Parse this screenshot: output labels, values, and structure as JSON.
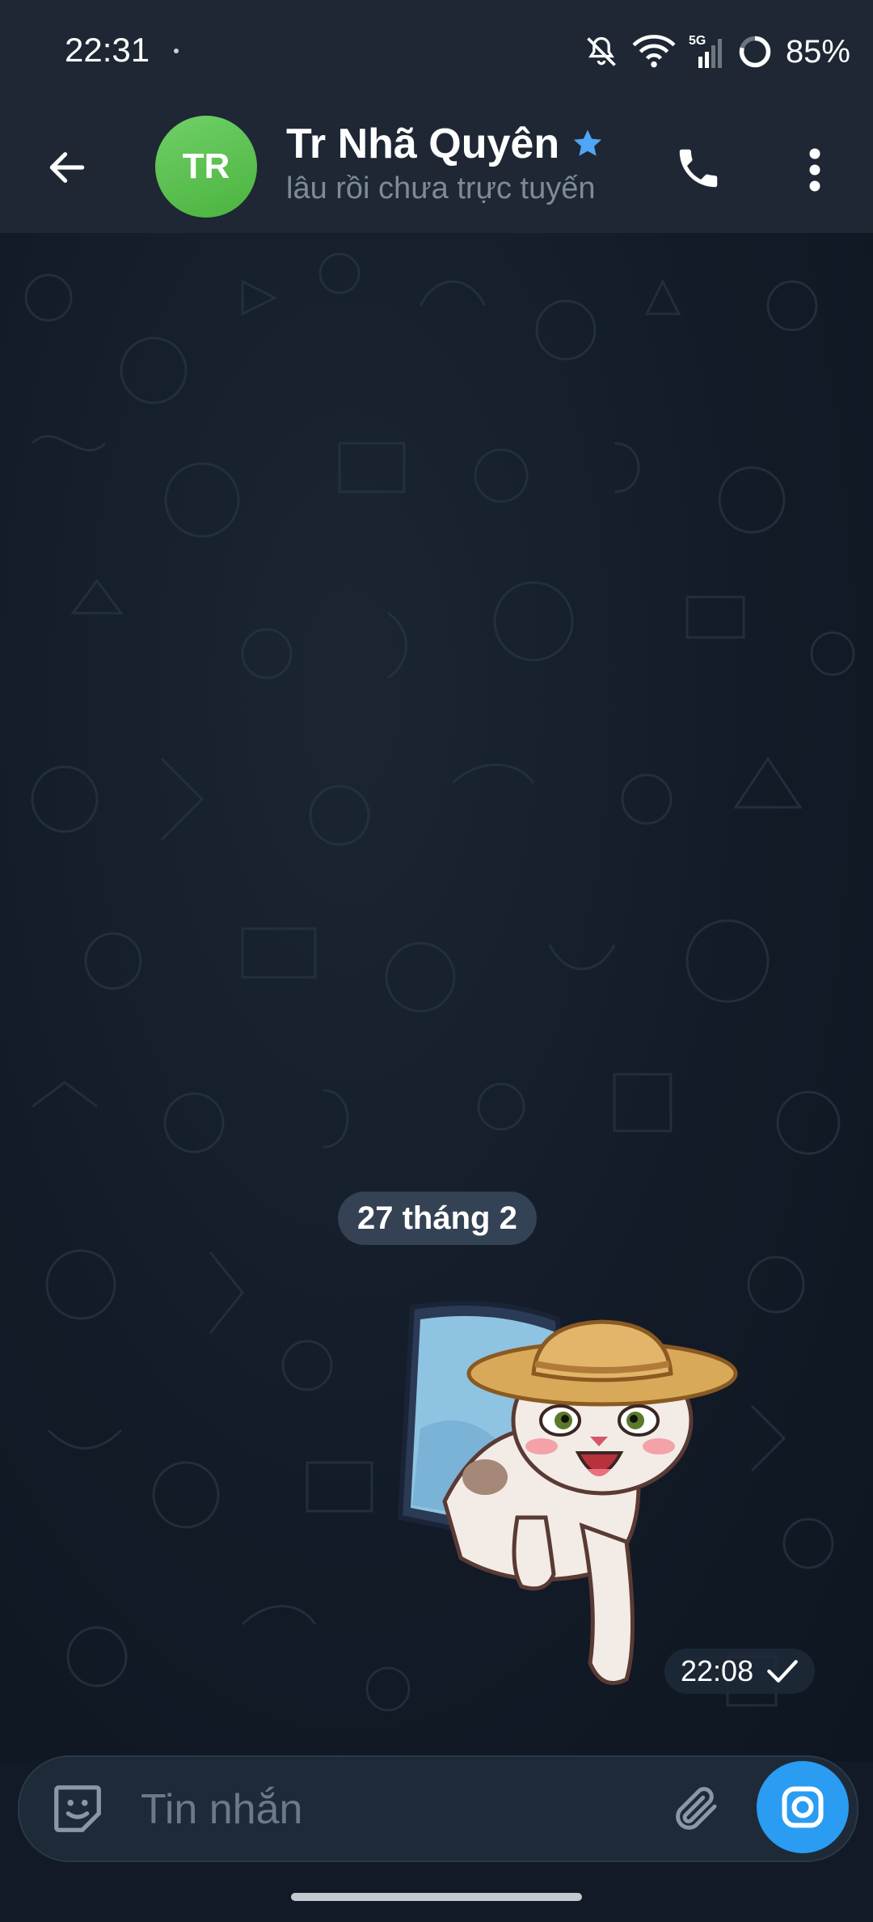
{
  "status_bar": {
    "time": "22:31",
    "network": "5G",
    "battery": "85%",
    "icons": [
      "mute-icon",
      "wifi-icon",
      "signal-icon",
      "battery-icon"
    ]
  },
  "header": {
    "avatar_initials": "TR",
    "avatar_color": "#5cc150",
    "name": "Tr Nhã Quyên",
    "status": "lâu rồi chưa trực tuyến",
    "badge_icon": "star-icon",
    "badge_color": "#4ea6f5"
  },
  "chat": {
    "date_separator": "27 tháng 2",
    "messages": [
      {
        "type": "sticker",
        "description_icon": "cat-sticker",
        "time": "22:08",
        "status_icon": "check-icon"
      }
    ]
  },
  "composer": {
    "placeholder": "Tin nhắn",
    "value": ""
  },
  "colors": {
    "bar_background": "#1e2733",
    "chat_background": "#111a26",
    "accent": "#2a9cf2"
  }
}
